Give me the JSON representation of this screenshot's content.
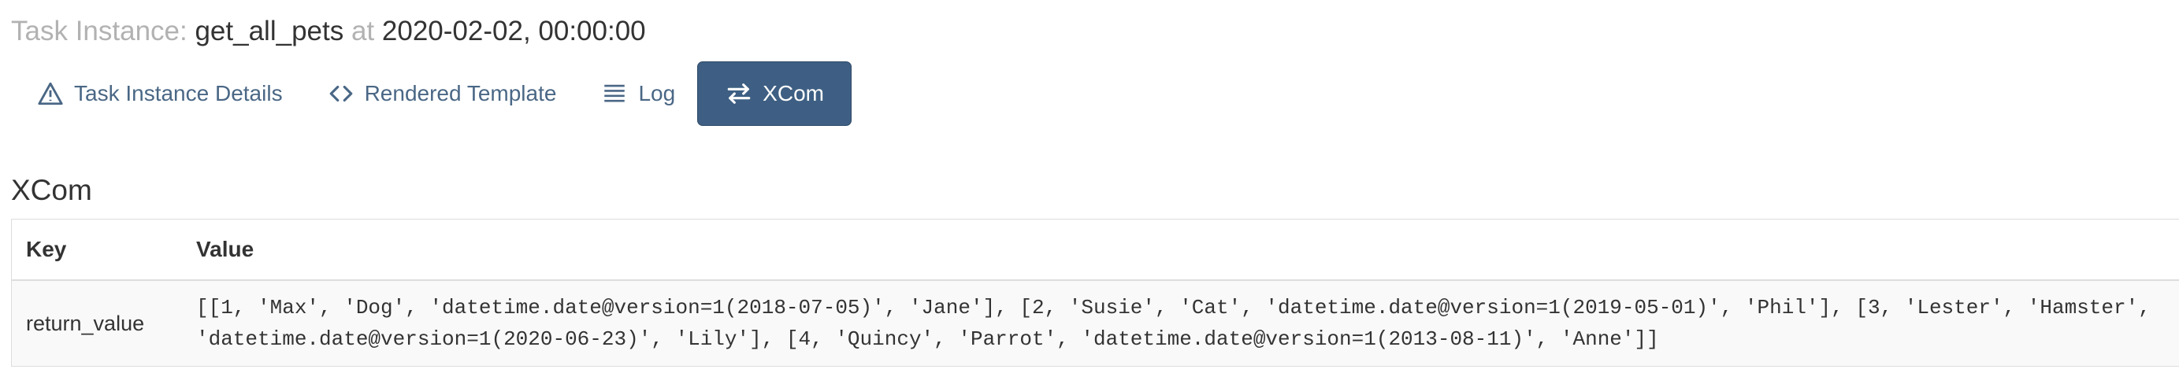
{
  "header": {
    "prefix": "Task Instance:",
    "task_id": "get_all_pets",
    "at": "at",
    "execution_date": "2020-02-02, 00:00:00"
  },
  "tabs": [
    {
      "label": "Task Instance Details",
      "icon": "warning-triangle-icon",
      "active": false
    },
    {
      "label": "Rendered Template",
      "icon": "code-brackets-icon",
      "active": false
    },
    {
      "label": "Log",
      "icon": "list-lines-icon",
      "active": false
    },
    {
      "label": "XCom",
      "icon": "swap-arrows-icon",
      "active": true
    }
  ],
  "colors": {
    "accent": "#3e5f83",
    "link": "#4a6785",
    "muted": "#b2b2b2"
  },
  "section": {
    "title": "XCom"
  },
  "table": {
    "columns": [
      "Key",
      "Value"
    ],
    "rows": [
      {
        "key": "return_value",
        "value": "[[1, 'Max', 'Dog', 'datetime.date@version=1(2018-07-05)', 'Jane'], [2, 'Susie', 'Cat', 'datetime.date@version=1(2019-05-01)', 'Phil'], [3, 'Lester', 'Hamster', 'datetime.date@version=1(2020-06-23)', 'Lily'], [4, 'Quincy', 'Parrot', 'datetime.date@version=1(2013-08-11)', 'Anne']]"
      }
    ]
  }
}
